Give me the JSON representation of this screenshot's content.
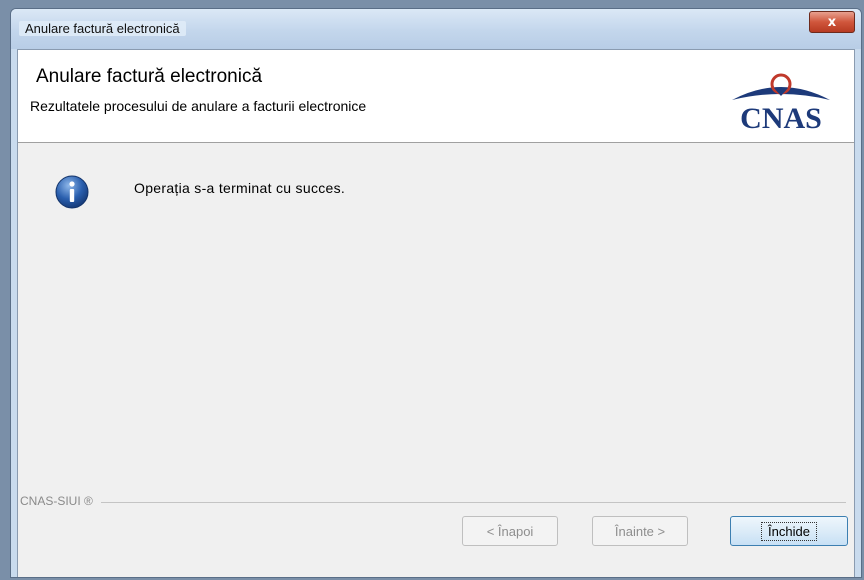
{
  "window": {
    "title": "Anulare factură electronică",
    "close_glyph": "x"
  },
  "header": {
    "title": "Anulare factură electronică",
    "subtitle": "Rezultatele procesului de anulare a facturii electronice",
    "logo_text": "CNAS"
  },
  "content": {
    "icon": "info-icon",
    "message": "Operația s-a terminat cu succes."
  },
  "footer": {
    "brand": "CNAS-SIUI ®",
    "buttons": {
      "back": "< Înapoi",
      "next": "Înainte >",
      "close": "Închide"
    }
  },
  "colors": {
    "titlebar": "#c9dbee",
    "close_button": "#d0563c",
    "client_bg": "#f0f0f0",
    "info_icon": "#2a5fae",
    "logo": "#1d3a7a",
    "logo_accent": "#c0392b"
  }
}
